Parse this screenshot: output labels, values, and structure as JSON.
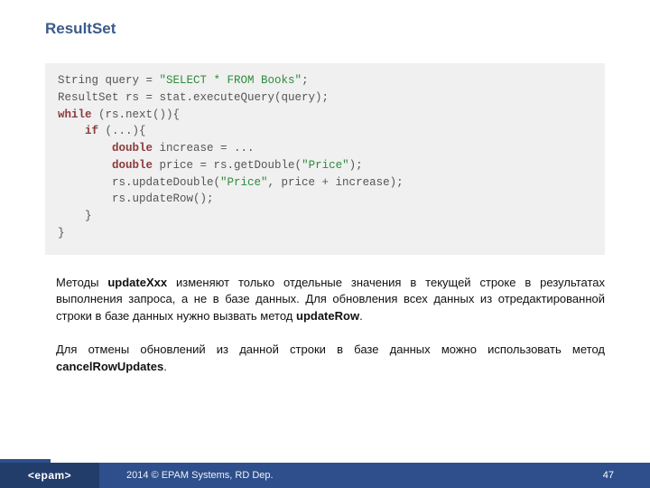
{
  "title": "ResultSet",
  "code_lines": [
    [
      {
        "t": "String query = "
      },
      {
        "t": "\"SELECT * FROM Books\"",
        "cls": "cb-str"
      },
      {
        "t": ";"
      }
    ],
    [
      {
        "t": "ResultSet rs = stat.executeQuery(query);"
      }
    ],
    [
      {
        "t": "while",
        "cls": "cb-kw"
      },
      {
        "t": " (rs.next()){"
      }
    ],
    [
      {
        "t": "    "
      },
      {
        "t": "if",
        "cls": "cb-kw"
      },
      {
        "t": " (...){"
      }
    ],
    [
      {
        "t": "        "
      },
      {
        "t": "double",
        "cls": "cb-kw"
      },
      {
        "t": " increase = ..."
      }
    ],
    [
      {
        "t": "        "
      },
      {
        "t": "double",
        "cls": "cb-kw"
      },
      {
        "t": " price = rs.getDouble("
      },
      {
        "t": "\"Price\"",
        "cls": "cb-str"
      },
      {
        "t": ");"
      }
    ],
    [
      {
        "t": "        rs.updateDouble("
      },
      {
        "t": "\"Price\"",
        "cls": "cb-str"
      },
      {
        "t": ", price + increase);"
      }
    ],
    [
      {
        "t": "        rs.updateRow();"
      }
    ],
    [
      {
        "t": "    }"
      }
    ],
    [
      {
        "t": "}"
      }
    ]
  ],
  "paragraphs": [
    [
      {
        "t": "Методы "
      },
      {
        "t": "updateXxx",
        "b": true
      },
      {
        "t": " изменяют только отдельные значения в текущей строке в результатах выполнения запроса, а не в базе данных. Для обновления всех данных из отредактированной строки в базе данных нужно вызвать метод "
      },
      {
        "t": "updateRow",
        "b": true
      },
      {
        "t": "."
      }
    ],
    [
      {
        "t": "Для отмены обновлений из данной строки в базе данных можно использовать метод "
      },
      {
        "t": "cancelRowUpdates",
        "b": true
      },
      {
        "t": "."
      }
    ]
  ],
  "footer": {
    "logo": "<epam>",
    "copyright": "2014 © EPAM Systems, RD Dep.",
    "page": "47"
  }
}
